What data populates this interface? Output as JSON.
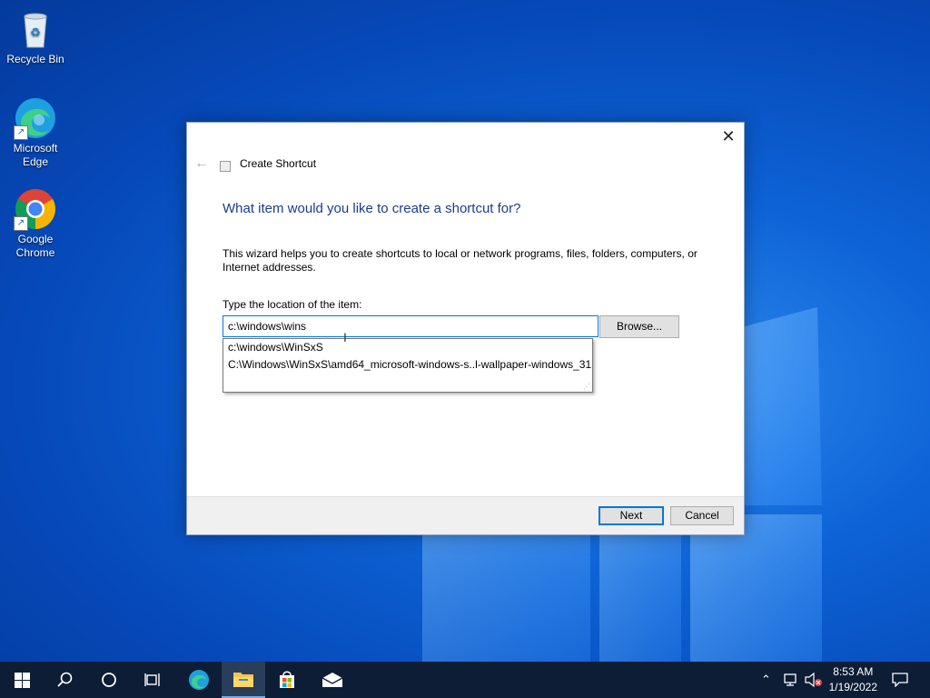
{
  "desktop": {
    "icons": [
      {
        "label": "Recycle Bin"
      },
      {
        "label": "Microsoft Edge"
      },
      {
        "label": "Google Chrome"
      }
    ]
  },
  "dialog": {
    "title": "Create Shortcut",
    "heading": "What item would you like to create a shortcut for?",
    "description": "This wizard helps you to create shortcuts to local or network programs, files, folders, computers, or Internet addresses.",
    "location_label": "Type the location of the item:",
    "location_value": "c:\\windows\\wins",
    "browse_label": "Browse...",
    "suggestions": [
      "c:\\windows\\WinSxS",
      "C:\\Windows\\WinSxS\\amd64_microsoft-windows-s..l-wallpaper-windows_31"
    ],
    "next_label": "Next",
    "cancel_label": "Cancel"
  },
  "taskbar": {
    "time": "8:53 AM",
    "date": "1/19/2022",
    "items": [
      "start-icon",
      "search-icon",
      "cortana-icon",
      "task-view-icon",
      "edge-icon",
      "file-explorer-icon",
      "store-icon",
      "mail-icon"
    ]
  },
  "colors": {
    "accent": "#0078d7",
    "heading": "#1c3c8c",
    "taskbar": "#0d1d36"
  }
}
